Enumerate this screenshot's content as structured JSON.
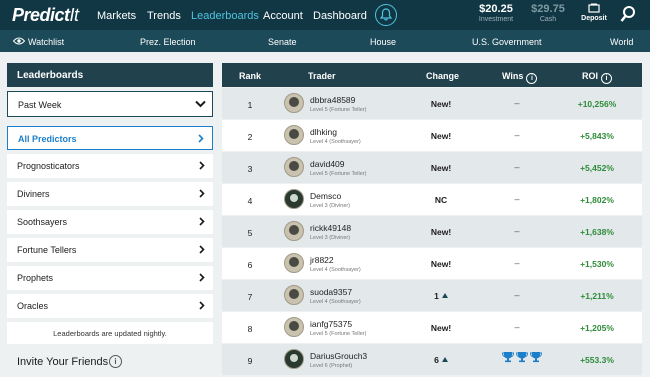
{
  "header": {
    "logo_bold": "Predict",
    "logo_light": "It",
    "nav": [
      "Markets",
      "Trends",
      "Leaderboards",
      "Account",
      "Dashboard"
    ],
    "investment_amount": "$20.25",
    "investment_label": "Investment",
    "cash_amount": "$29.75",
    "cash_label": "Cash",
    "deposit_label": "Deposit"
  },
  "subnav": {
    "watchlist": "Watchlist",
    "items": [
      "Prez. Election",
      "Senate",
      "House",
      "U.S. Government",
      "World"
    ]
  },
  "sidebar": {
    "title": "Leaderboards",
    "period": "Past Week",
    "items": [
      "All Predictors",
      "Prognosticators",
      "Diviners",
      "Soothsayers",
      "Fortune Tellers",
      "Prophets",
      "Oracles"
    ],
    "note": "Leaderboards are updated nightly.",
    "invite": "Invite Your Friends",
    "invite_info": "i"
  },
  "table": {
    "headers": {
      "rank": "Rank",
      "trader": "Trader",
      "change": "Change",
      "wins": "Wins",
      "roi": "ROI",
      "info": "i"
    },
    "rows": [
      {
        "rank": "1",
        "name": "dbbra48589",
        "level": "Level 5 (Fortune Teller)",
        "change": "New!",
        "wins": "–",
        "roi": "+10,256%"
      },
      {
        "rank": "2",
        "name": "dlhking",
        "level": "Level 4 (Soothsayer)",
        "change": "New!",
        "wins": "–",
        "roi": "+5,843%"
      },
      {
        "rank": "3",
        "name": "david409",
        "level": "Level 5 (Fortune Teller)",
        "change": "New!",
        "wins": "–",
        "roi": "+5,452%"
      },
      {
        "rank": "4",
        "name": "Demsco",
        "level": "Level 3 (Diviner)",
        "change": "NC",
        "wins": "–",
        "roi": "+1,802%"
      },
      {
        "rank": "5",
        "name": "rickk49148",
        "level": "Level 3 (Diviner)",
        "change": "New!",
        "wins": "–",
        "roi": "+1,638%"
      },
      {
        "rank": "6",
        "name": "jr8822",
        "level": "Level 4 (Soothsayer)",
        "change": "New!",
        "wins": "–",
        "roi": "+1,530%"
      },
      {
        "rank": "7",
        "name": "suoda9357",
        "level": "Level 4 (Soothsayer)",
        "change": "1",
        "wins": "–",
        "roi": "+1,211%"
      },
      {
        "rank": "8",
        "name": "ianfg75375",
        "level": "Level 5 (Fortune Teller)",
        "change": "New!",
        "wins": "–",
        "roi": "+1,205%"
      },
      {
        "rank": "9",
        "name": "DariusGrouch3",
        "level": "Level 6 (Prophet)",
        "change": "6",
        "wins": "",
        "roi": "+553.3%"
      }
    ]
  },
  "colors": {
    "topbar": "#113744",
    "subbar": "#1d4a58",
    "accent": "#4fc3e0",
    "active_link": "#1d7fc9",
    "roi_green": "#2e8b3a",
    "trophy": "#1d7fc9"
  }
}
